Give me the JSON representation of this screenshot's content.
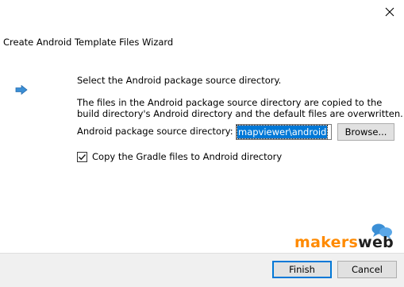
{
  "window": {
    "title": "Create Android Template Files Wizard",
    "close_icon": "close-icon"
  },
  "content": {
    "arrow_icon": "arrow-right-icon",
    "instruction": "Select the Android package source directory.",
    "description_line1": "The files in the Android package source directory are copied to the",
    "description_line2": "build directory's Android directory and the default files are overwritten.",
    "dir_label": "Android package source directory:",
    "dir_value": "mapviewer\\android",
    "browse_label": "Browse...",
    "gradle_checkbox_label": "Copy the Gradle files to Android directory",
    "gradle_checkbox_checked": true
  },
  "footer": {
    "finish_label": "Finish",
    "cancel_label": "Cancel"
  },
  "watermark": {
    "brand_prefix": "makers",
    "brand_suffix": "web",
    "brand_color": "#ff8a00",
    "bubble_color": "#3b8fd6"
  },
  "colors": {
    "accent": "#0078d7",
    "arrow": "#3b8fd6",
    "footer_bg": "#f0f0f0",
    "button_bg": "#e1e1e1"
  }
}
